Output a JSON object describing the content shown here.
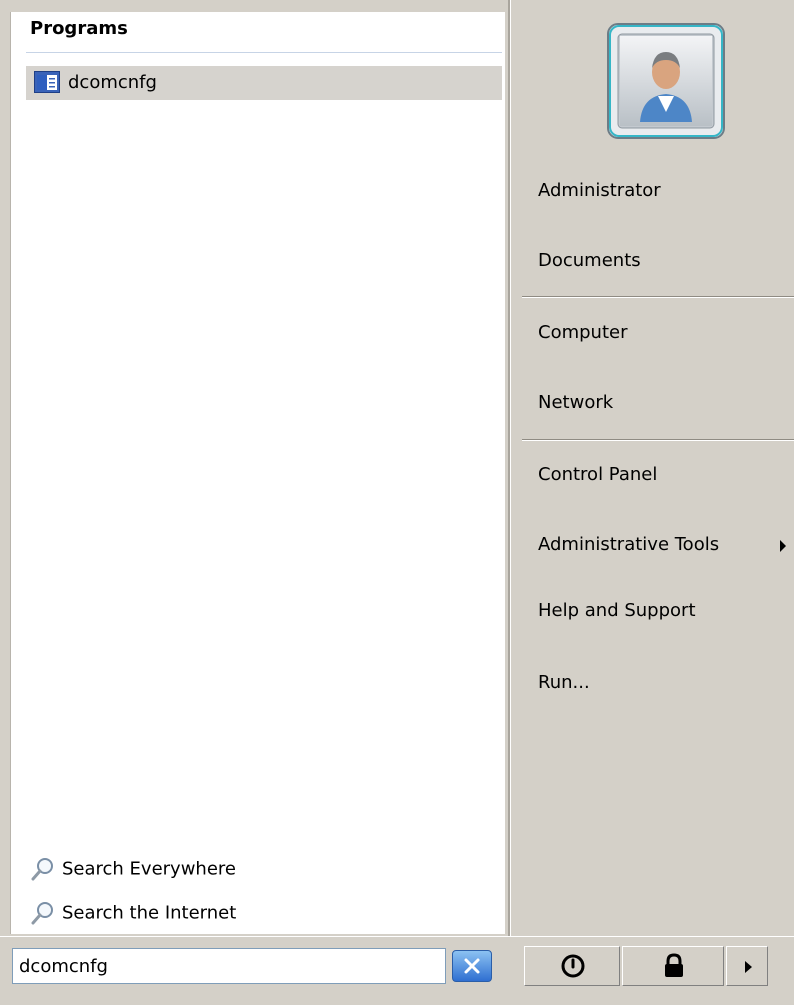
{
  "programs": {
    "header": "Programs",
    "items": [
      {
        "label": "dcomcnfg",
        "icon": "console-window-icon"
      }
    ]
  },
  "search_links": [
    {
      "label": "Search Everywhere",
      "icon": "magnifier-icon"
    },
    {
      "label": "Search the Internet",
      "icon": "magnifier-icon"
    }
  ],
  "search_box": {
    "value": "dcomcnfg"
  },
  "right_pane": {
    "avatar_icon": "user-avatar-icon",
    "group1": [
      "Administrator",
      "Documents"
    ],
    "group2": [
      "Computer",
      "Network"
    ],
    "group3": [
      "Control Panel",
      "Administrative Tools",
      "Help and Support",
      "Run..."
    ]
  },
  "power_buttons": {
    "power_icon": "power-icon",
    "lock_icon": "lock-icon",
    "more_icon": "arrow-right-icon"
  },
  "colors": {
    "panel": "#d4d0c8",
    "highlight": "#d6d3ce",
    "header_rule": "#c7d4e6"
  }
}
